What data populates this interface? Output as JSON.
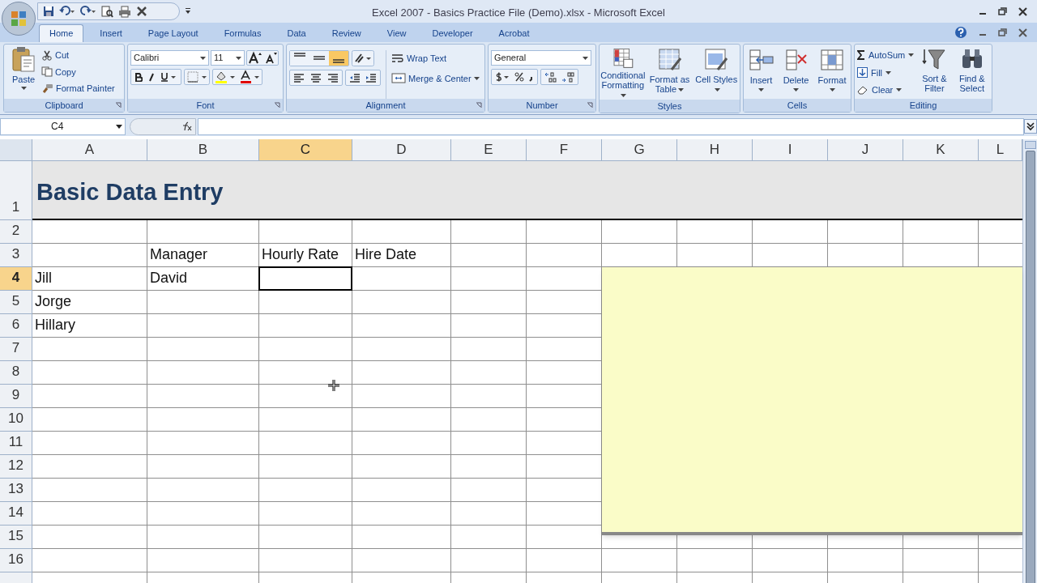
{
  "window": {
    "title": "Excel 2007 - Basics Practice File (Demo).xlsx - Microsoft Excel"
  },
  "tabs": [
    {
      "label": "Home",
      "selected": true
    },
    {
      "label": "Insert",
      "selected": false
    },
    {
      "label": "Page Layout",
      "selected": false
    },
    {
      "label": "Formulas",
      "selected": false
    },
    {
      "label": "Data",
      "selected": false
    },
    {
      "label": "Review",
      "selected": false
    },
    {
      "label": "View",
      "selected": false
    },
    {
      "label": "Developer",
      "selected": false
    },
    {
      "label": "Acrobat",
      "selected": false
    }
  ],
  "ribbon": {
    "clipboard": {
      "label": "Clipboard",
      "paste": "Paste",
      "cut": "Cut",
      "copy": "Copy",
      "format_painter": "Format Painter"
    },
    "font": {
      "label": "Font",
      "font_name": "Calibri",
      "font_size": "11"
    },
    "alignment": {
      "label": "Alignment",
      "vertical_align": [
        {
          "selected": false
        },
        {
          "selected": false
        },
        {
          "selected": true
        }
      ],
      "wrap_text": "Wrap Text",
      "merge_center": "Merge & Center"
    },
    "number": {
      "label": "Number",
      "format": "General"
    },
    "styles": {
      "label": "Styles",
      "buttons": [
        "Conditional Formatting",
        "Format as Table",
        "Cell Styles"
      ]
    },
    "cells": {
      "label": "Cells",
      "buttons": [
        "Insert",
        "Delete",
        "Format"
      ]
    },
    "editing": {
      "label": "Editing",
      "autosum": "AutoSum",
      "fill": "Fill",
      "clear": "Clear",
      "sort_filter": "Sort & Filter",
      "find_select": "Find & Select"
    }
  },
  "formula_bar": {
    "name_box": "C4"
  },
  "sheet": {
    "columns": [
      {
        "label": "A",
        "selected": false
      },
      {
        "label": "B",
        "selected": false
      },
      {
        "label": "C",
        "selected": true
      },
      {
        "label": "D",
        "selected": false
      },
      {
        "label": "E",
        "selected": false
      },
      {
        "label": "F",
        "selected": false
      },
      {
        "label": "G",
        "selected": false
      },
      {
        "label": "H",
        "selected": false
      },
      {
        "label": "I",
        "selected": false
      },
      {
        "label": "J",
        "selected": false
      },
      {
        "label": "K",
        "selected": false
      },
      {
        "label": "L",
        "selected": false
      }
    ],
    "rows": [
      {
        "number": "1",
        "selected": false,
        "cells": [
          "Basic Data Entry"
        ]
      },
      {
        "number": "2",
        "selected": false
      },
      {
        "number": "3",
        "selected": false,
        "cells": [
          "",
          "Manager",
          "Hourly Rate",
          "Hire Date"
        ]
      },
      {
        "number": "4",
        "selected": true,
        "cells": [
          "Jill",
          "David"
        ]
      },
      {
        "number": "5",
        "selected": false,
        "cells": [
          "Jorge"
        ]
      },
      {
        "number": "6",
        "selected": false,
        "cells": [
          "Hillary"
        ]
      },
      {
        "number": "7",
        "selected": false
      },
      {
        "number": "8",
        "selected": false
      },
      {
        "number": "9",
        "selected": false
      },
      {
        "number": "10",
        "selected": false
      },
      {
        "number": "11",
        "selected": false
      },
      {
        "number": "12",
        "selected": false
      },
      {
        "number": "13",
        "selected": false
      },
      {
        "number": "14",
        "selected": false
      },
      {
        "number": "15",
        "selected": false
      },
      {
        "number": "16",
        "selected": false
      }
    ]
  }
}
